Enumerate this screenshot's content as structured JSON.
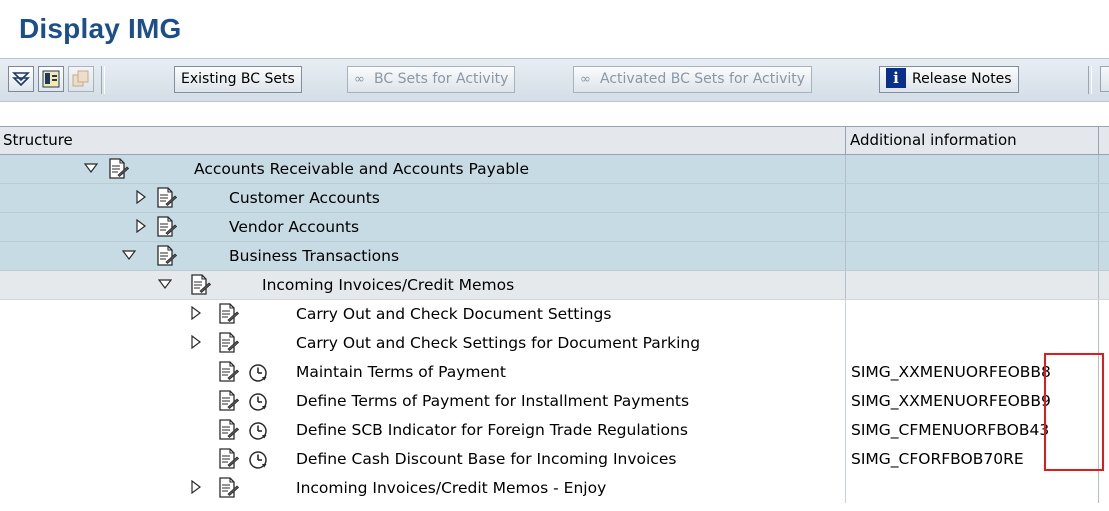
{
  "window": {
    "title": "Display IMG"
  },
  "toolbar": {
    "buttons": [
      {
        "label": "Existing BC Sets",
        "enabled": true
      },
      {
        "label": "BC Sets for Activity",
        "enabled": false
      },
      {
        "label": "Activated BC Sets for Activity",
        "enabled": false
      },
      {
        "label": "Release Notes",
        "enabled": true
      }
    ]
  },
  "table": {
    "headers": {
      "structure": "Structure",
      "info": "Additional information"
    },
    "rows": [
      {
        "label": "Accounts Receivable and Accounts Payable",
        "expander": "expanded",
        "info": ""
      },
      {
        "label": "Customer Accounts",
        "expander": "collapsed",
        "info": ""
      },
      {
        "label": "Vendor Accounts",
        "expander": "collapsed",
        "info": ""
      },
      {
        "label": "Business Transactions",
        "expander": "expanded",
        "info": ""
      },
      {
        "label": "Incoming Invoices/Credit Memos",
        "expander": "expanded",
        "info": ""
      },
      {
        "label": "Carry Out and Check Document Settings",
        "expander": "collapsed",
        "info": ""
      },
      {
        "label": "Carry Out and Check Settings for Document Parking",
        "expander": "collapsed",
        "info": ""
      },
      {
        "label": "Maintain Terms of Payment",
        "expander": "none",
        "info": "SIMG_XXMENUORFEOBB8"
      },
      {
        "label": "Define Terms of Payment for Installment Payments",
        "expander": "none",
        "info": "SIMG_XXMENUORFEOBB9"
      },
      {
        "label": "Define SCB Indicator for Foreign Trade Regulations",
        "expander": "none",
        "info": "SIMG_CFMENUORFBOB43"
      },
      {
        "label": "Define Cash Discount Base for Incoming Invoices",
        "expander": "none",
        "info": "SIMG_CFORFBOB70RE"
      },
      {
        "label": "Incoming Invoices/Credit Memos - Enjoy",
        "expander": "collapsed",
        "info": ""
      }
    ]
  },
  "colors": {
    "title": "#1c4f8a",
    "highlight": "#e11b1b",
    "row_blue": "#c7dbe5",
    "row_gray": "#e6e9ec"
  }
}
